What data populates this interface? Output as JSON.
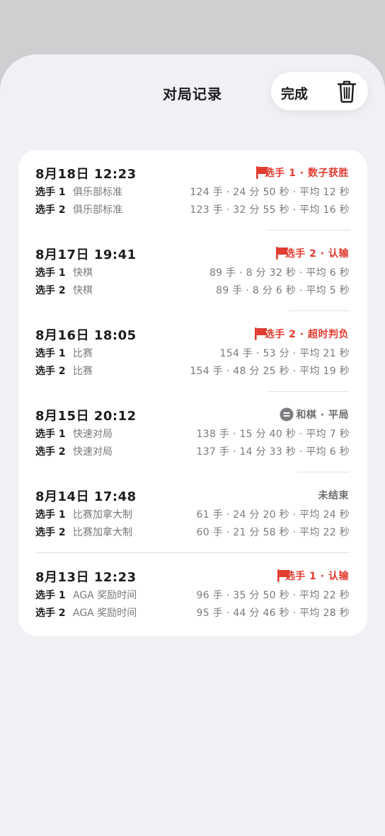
{
  "header": {
    "title": "对局记录",
    "done_label": "完成",
    "trash_icon": "trash-icon"
  },
  "games": [
    {
      "date": "8月18日 12:23",
      "result": "选手 1 · 数子获胜",
      "result_icon": "flag-icon",
      "p1": {
        "label": "选手 1",
        "time_control": "俱乐部标准",
        "stats": "124 手 · 24 分 50 秒 · 平均 12 秒"
      },
      "p2": {
        "label": "选手 2",
        "time_control": "俱乐部标准",
        "stats": "123 手 · 32 分 55 秒 · 平均 16 秒"
      }
    },
    {
      "date": "8月17日 19:41",
      "result": "选手 2 · 认输",
      "result_icon": "flag-icon",
      "p1": {
        "label": "选手 1",
        "time_control": "快棋",
        "stats": "89 手 · 8 分 32 秒 · 平均 6 秒"
      },
      "p2": {
        "label": "选手 2",
        "time_control": "快棋",
        "stats": "89 手 · 8 分 6 秒 · 平均 5 秒"
      }
    },
    {
      "date": "8月16日 18:05",
      "result": "选手 2 · 超时判负",
      "result_icon": "flag-icon",
      "p1": {
        "label": "选手 1",
        "time_control": "比赛",
        "stats": "154 手 · 53 分 · 平均 21 秒"
      },
      "p2": {
        "label": "选手 2",
        "time_control": "比赛",
        "stats": "154 手 · 48 分 25 秒 · 平均 19 秒"
      }
    },
    {
      "date": "8月15日 20:12",
      "result": "和棋 · 平局",
      "result_icon": "equals-icon",
      "p1": {
        "label": "选手 1",
        "time_control": "快速对局",
        "stats": "138 手 · 15 分 40 秒 · 平均 7 秒"
      },
      "p2": {
        "label": "选手 2",
        "time_control": "快速对局",
        "stats": "137 手 · 14 分 33 秒 · 平均 6 秒"
      }
    },
    {
      "date": "8月14日 17:48",
      "result": "未结束",
      "result_icon": "",
      "p1": {
        "label": "选手 1",
        "time_control": "比赛加拿大制",
        "stats": "61 手 · 24 分 20 秒 · 平均 24 秒"
      },
      "p2": {
        "label": "选手 2",
        "time_control": "比赛加拿大制",
        "stats": "60 手 · 21 分 58 秒 · 平均 22 秒"
      }
    },
    {
      "date": "8月13日 12:23",
      "result": "选手 1 · 认输",
      "result_icon": "flag-icon",
      "p1": {
        "label": "选手 1",
        "time_control": "AGA 奖励时间",
        "stats": "96 手 · 35 分 50 秒 · 平均 22 秒"
      },
      "p2": {
        "label": "选手 2",
        "time_control": "AGA 奖励时间",
        "stats": "95 手 · 44 分 46 秒 · 平均 28 秒"
      }
    }
  ],
  "colors": {
    "loss_red": "#e23b2f",
    "muted": "#7a7a7e",
    "sheet_bg": "#f1f1f5"
  }
}
